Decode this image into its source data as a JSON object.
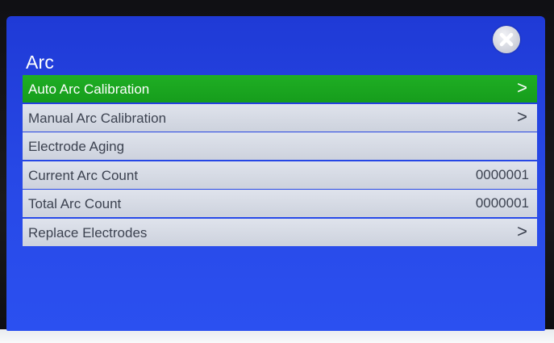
{
  "screen": {
    "title": "Arc",
    "close_icon": "close-icon"
  },
  "menu": {
    "items": [
      {
        "label": "Auto Arc Calibration",
        "value": "",
        "chevron": ">",
        "selected": true
      },
      {
        "label": "Manual Arc Calibration",
        "value": "",
        "chevron": ">",
        "selected": false
      },
      {
        "label": "Electrode Aging",
        "value": "",
        "chevron": "",
        "selected": false
      },
      {
        "label": "Current Arc Count",
        "value": "0000001",
        "chevron": "",
        "selected": false
      },
      {
        "label": "Total Arc Count",
        "value": "0000001",
        "chevron": "",
        "selected": false
      },
      {
        "label": "Replace Electrodes",
        "value": "",
        "chevron": ">",
        "selected": false
      }
    ]
  },
  "colors": {
    "screen_bg": "#2748e6",
    "row_bg": "#d4d9e3",
    "selected_bg": "#1aa520",
    "row_text": "#3c4250"
  }
}
